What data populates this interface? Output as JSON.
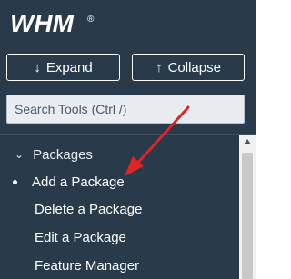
{
  "app": {
    "logo_text": "WHM"
  },
  "toolbar": {
    "expand_label": "Expand",
    "collapse_label": "Collapse",
    "expand_icon": "arrow-down",
    "collapse_icon": "arrow-up"
  },
  "search": {
    "placeholder": "Search Tools (Ctrl /)"
  },
  "menu": {
    "section_label": "Packages",
    "items": [
      {
        "label": "Add a Package",
        "active": true
      },
      {
        "label": "Delete a Package"
      },
      {
        "label": "Edit a Package"
      },
      {
        "label": "Feature Manager"
      }
    ]
  },
  "colors": {
    "sidebar_bg": "#293a4a",
    "annotation_arrow": "#e02424"
  }
}
